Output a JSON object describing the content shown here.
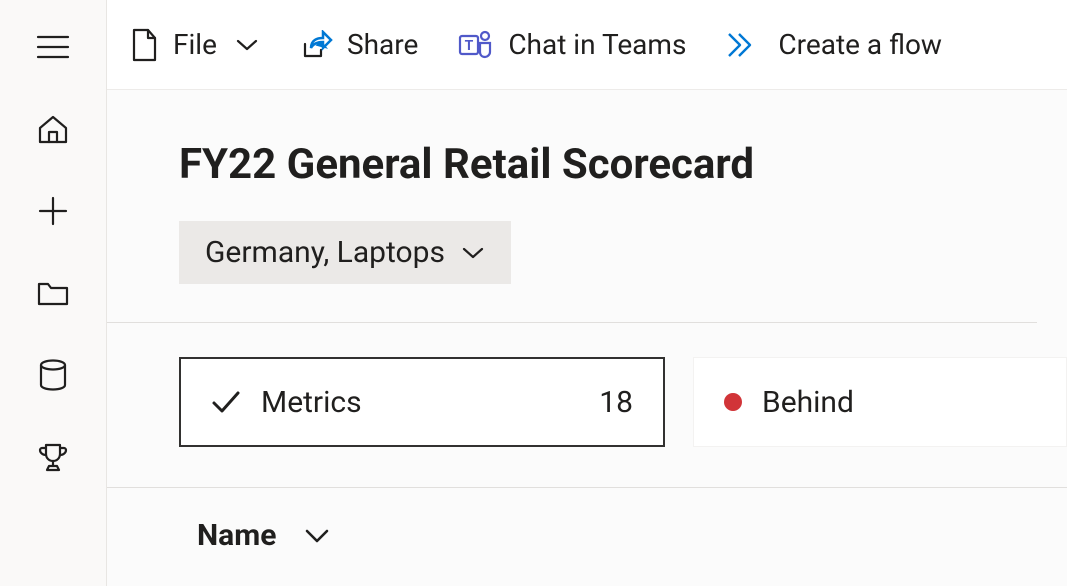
{
  "topbar": {
    "file_label": "File",
    "share_label": "Share",
    "chat_label": "Chat in Teams",
    "flow_label": "Create a flow"
  },
  "page": {
    "title": "FY22 General Retail Scorecard",
    "filter_label": "Germany, Laptops"
  },
  "summary": {
    "metrics_label": "Metrics",
    "metrics_count": "18",
    "behind_label": "Behind"
  },
  "table": {
    "col_name": "Name"
  }
}
